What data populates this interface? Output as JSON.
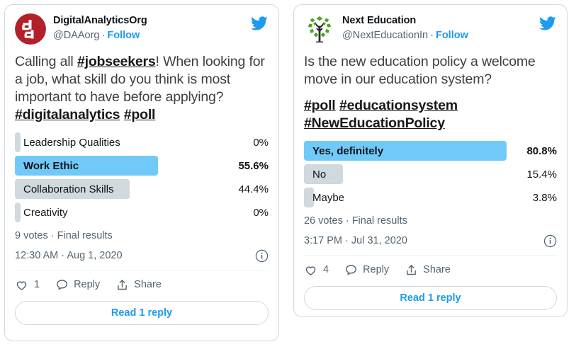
{
  "cards": [
    {
      "id": "digital-analytics-org",
      "display_name": "DigitalAnalyticsOrg",
      "handle": "@DAAorg",
      "separator": "·",
      "follow_label": "Follow",
      "avatar_icon": "da-monogram-avatar",
      "bird_icon": "twitter-bird-icon",
      "text": {
        "line1_pre": "Calling all ",
        "line1_tag": "#jobseekers",
        "line1_post": "! When looking for a job, what skill do you think is most important to have before applying?",
        "tags": [
          "#digitalanalytics",
          "#poll"
        ]
      },
      "poll": {
        "options": [
          {
            "label": "Leadership Qualities",
            "pct_label": "0%",
            "pct": 0,
            "winner": false
          },
          {
            "label": "Work Ethic",
            "pct_label": "55.6%",
            "pct": 55.6,
            "winner": true
          },
          {
            "label": "Collaboration Skills",
            "pct_label": "44.4%",
            "pct": 44.4,
            "winner": false
          },
          {
            "label": "Creativity",
            "pct_label": "0%",
            "pct": 0,
            "winner": false
          }
        ],
        "meta": "9 votes · Final results"
      },
      "timestamp": "12:30 AM · Aug 1, 2020",
      "info_icon": "info-circle-icon",
      "actions": {
        "like_icon": "heart-icon",
        "like_count": "1",
        "reply_icon": "reply-bubble-icon",
        "reply_label": "Reply",
        "share_icon": "share-arrow-icon",
        "share_label": "Share"
      },
      "read_reply_label": "Read 1 reply"
    },
    {
      "id": "next-education",
      "display_name": "Next Education",
      "handle": "@NextEducationIn",
      "separator": "·",
      "follow_label": "Follow",
      "avatar_icon": "green-tree-avatar",
      "bird_icon": "twitter-bird-icon",
      "text": {
        "line1_pre": "Is the new education policy a welcome move in our education system?",
        "line1_tag": "",
        "line1_post": "",
        "tags": [
          "#poll",
          "#educationsystem",
          "#NewEducationPolicy"
        ]
      },
      "poll": {
        "options": [
          {
            "label": "Yes, definitely",
            "pct_label": "80.8%",
            "pct": 80.8,
            "winner": true
          },
          {
            "label": "No",
            "pct_label": "15.4%",
            "pct": 15.4,
            "winner": false
          },
          {
            "label": "Maybe",
            "pct_label": "3.8%",
            "pct": 3.8,
            "winner": false
          }
        ],
        "meta": "26 votes · Final results"
      },
      "timestamp": "3:17 PM · Jul 31, 2020",
      "info_icon": "info-circle-icon",
      "actions": {
        "like_icon": "heart-icon",
        "like_count": "4",
        "reply_icon": "reply-bubble-icon",
        "reply_label": "Reply",
        "share_icon": "share-arrow-icon",
        "share_label": "Share"
      },
      "read_reply_label": "Read 1 reply"
    }
  ],
  "colors": {
    "twitter_blue": "#1d9bf0",
    "winner_bar": "#71c9f8",
    "other_bar": "#cfd9de",
    "card_border": "#cfd9de",
    "text_primary": "#0f1419",
    "text_secondary": "#536471",
    "avatar_red": "#b3202a",
    "avatar_green": "#4ca322"
  }
}
